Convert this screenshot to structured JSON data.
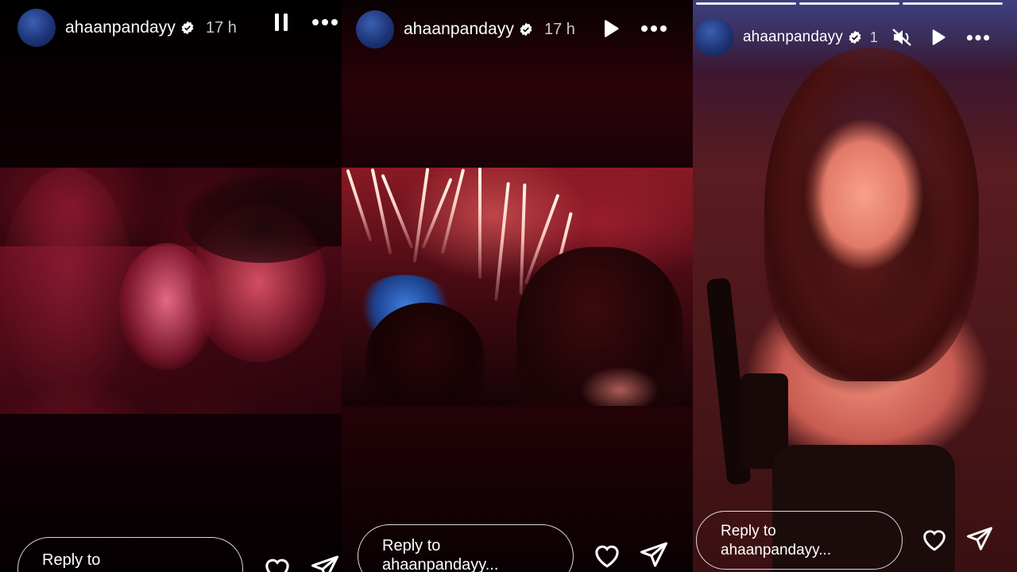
{
  "stories": [
    {
      "username": "ahaanpandayy",
      "age": "17 h",
      "playback_state": "playing",
      "media": "couple-photo",
      "reply": {
        "line1": "Reply to",
        "line2": ""
      }
    },
    {
      "username": "ahaanpandayy",
      "age": "17 h",
      "playback_state": "paused",
      "media": "fireworks-photo",
      "reply": {
        "line1": "Reply to",
        "line2": "ahaanpandayy..."
      }
    },
    {
      "username": "ahaanpandayy",
      "age": "1",
      "playback_state": "paused",
      "muted": true,
      "segments": 3,
      "media": "portrait-photo",
      "reply": {
        "line1": "Reply to",
        "line2": "ahaanpandayy..."
      }
    }
  ],
  "icons": {
    "verified": "verified-badge-icon",
    "pause": "pause-icon",
    "play": "play-icon",
    "more": "more-icon",
    "mute": "speaker-muted-icon",
    "like": "heart-icon",
    "share": "send-icon"
  },
  "colors": {
    "text": "#ffffff",
    "verified_bg": "#ffffff"
  }
}
